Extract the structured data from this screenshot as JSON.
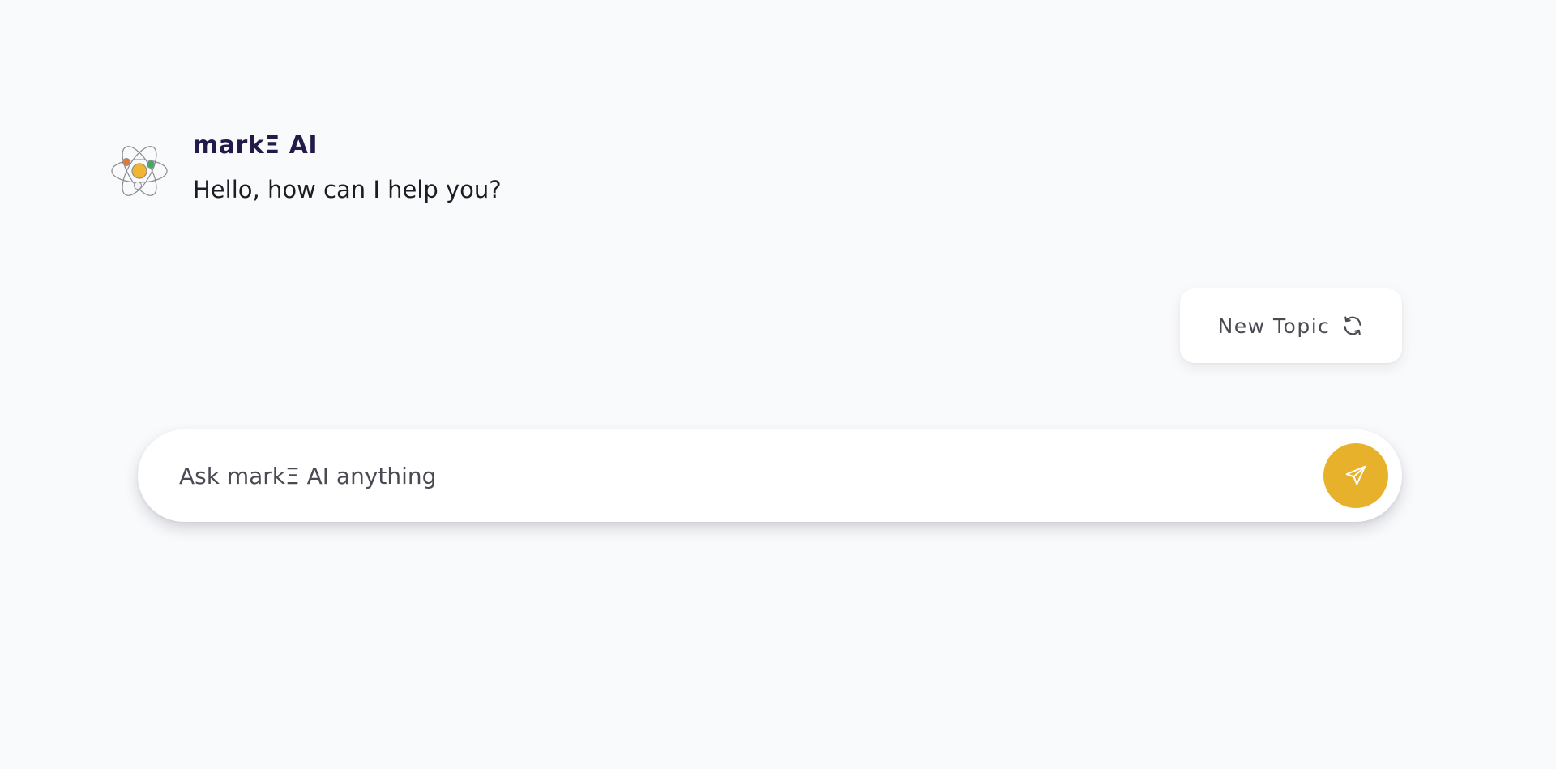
{
  "colors": {
    "background": "#f9fafc",
    "sender_name": "#231a4a",
    "accent": "#e8b12c",
    "icon_stroke": "#4a4a52",
    "avatar_orange": "#e07a3a",
    "avatar_green": "#3fae5c",
    "avatar_center": "#f2b533"
  },
  "message": {
    "avatar_icon": "atom-icon",
    "sender": "markΞ AI",
    "text": "Hello, how can I help you?"
  },
  "new_topic": {
    "label": "New Topic",
    "icon": "refresh-icon"
  },
  "prompt": {
    "placeholder": "Ask markΞ AI anything",
    "value": "",
    "send_icon": "paper-plane-icon"
  }
}
